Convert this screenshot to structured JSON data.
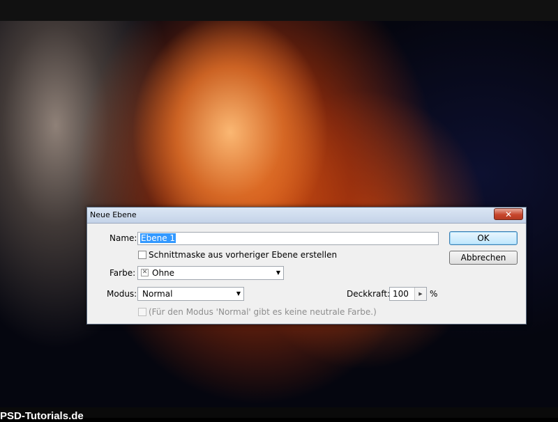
{
  "dialog": {
    "title": "Neue Ebene",
    "close_glyph": "✕",
    "name_label": "Name:",
    "name_value": "Ebene 1",
    "clip_mask_label": "Schnittmaske aus vorheriger Ebene erstellen",
    "color_label": "Farbe:",
    "color_value": "Ohne",
    "mode_label": "Modus:",
    "mode_value": "Normal",
    "opacity_label": "Deckkraft:",
    "opacity_value": "100",
    "opacity_unit": "%",
    "neutral_label": "(Für den Modus 'Normal' gibt es keine neutrale Farbe.)",
    "ok_label": "OK",
    "cancel_label": "Abbrechen"
  },
  "watermark": "PSD-Tutorials.de",
  "colors": {
    "selection": "#3399ff",
    "close_button": "#c7462d",
    "dialog_bg": "#f0f0f0"
  }
}
